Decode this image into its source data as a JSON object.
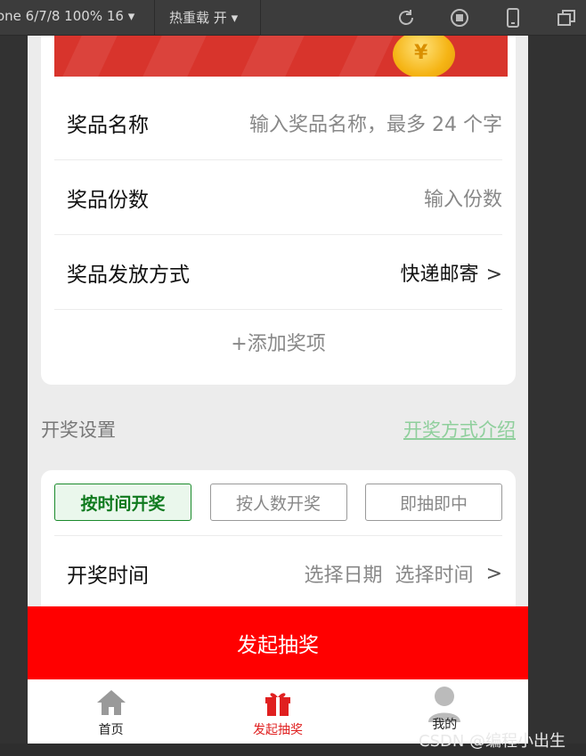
{
  "toolbar": {
    "device": "one 6/7/8 100% 16",
    "hot_reload": "热重载 开"
  },
  "prize": {
    "name_label": "奖品名称",
    "name_placeholder": "输入奖品名称，最多 24 个字",
    "count_label": "奖品份数",
    "count_placeholder": "输入份数",
    "method_label": "奖品发放方式",
    "method_value": "快递邮寄",
    "chevron": ">",
    "add_label": "+添加奖项"
  },
  "draw_settings": {
    "title": "开奖设置",
    "intro_link": "开奖方式介绍",
    "tabs": [
      "按时间开奖",
      "按人数开奖",
      "即抽即中"
    ],
    "active_tab": 0,
    "time_label": "开奖时间",
    "date_placeholder": "选择日期",
    "time_placeholder": "选择时间",
    "chevron": ">"
  },
  "submit_label": "发起抽奖",
  "tabbar": {
    "items": [
      {
        "label": "首页",
        "icon": "home-icon"
      },
      {
        "label": "发起抽奖",
        "icon": "gift-icon"
      },
      {
        "label": "我的",
        "icon": "user-icon"
      }
    ],
    "active": 1
  },
  "watermark": "CSDN @编程小出生",
  "colors": {
    "primary_red": "#ff0000",
    "active_green": "#0f7a1e",
    "link_green": "#8fcf9c",
    "active_tab_text": "#e02020"
  }
}
